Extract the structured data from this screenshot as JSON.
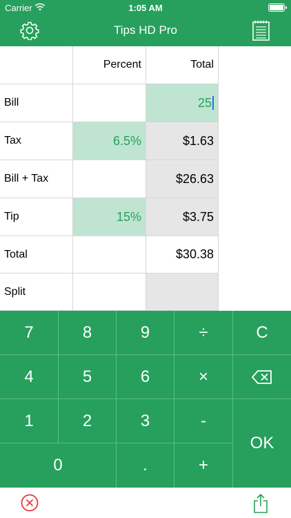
{
  "status": {
    "carrier": "Carrier",
    "time": "1:05 AM"
  },
  "nav": {
    "title": "Tips HD Pro",
    "settings_icon": "gear-icon",
    "notes_icon": "notepad-icon"
  },
  "table": {
    "headers": [
      "Percent",
      "Total"
    ],
    "rows": [
      {
        "label": "Bill",
        "percent": "",
        "total": "25"
      },
      {
        "label": "Tax",
        "percent": "6.5%",
        "total": "$1.63"
      },
      {
        "label": "Bill + Tax",
        "percent": "",
        "total": "$26.63"
      },
      {
        "label": "Tip",
        "percent": "15%",
        "total": "$3.75"
      },
      {
        "label": "Total",
        "percent": "",
        "total": "$30.38"
      },
      {
        "label": "Split",
        "percent": "",
        "total": ""
      }
    ]
  },
  "keypad": {
    "row1": [
      "7",
      "8",
      "9",
      "÷",
      "C"
    ],
    "row2": [
      "4",
      "5",
      "6",
      "×",
      "backspace"
    ],
    "row3": [
      "1",
      "2",
      "3",
      "-"
    ],
    "row4": [
      "0",
      ".",
      "+"
    ],
    "ok": "OK"
  },
  "bottom": {
    "close_icon": "close-circle-icon",
    "share_icon": "share-icon"
  },
  "colors": {
    "primary": "#26a05c",
    "highlight": "#bfe5d2",
    "readonly": "#e6e6e6",
    "close": "#e53945"
  }
}
